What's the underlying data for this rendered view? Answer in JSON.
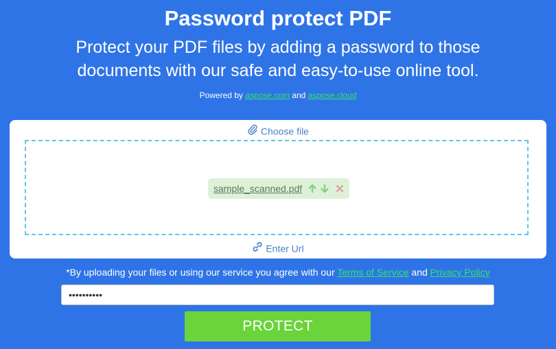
{
  "header": {
    "title": "Password protect PDF",
    "subtitle_line1": "Protect your PDF files by adding a password to those",
    "subtitle_line2": "documents with our safe and easy-to-use online tool.",
    "powered_prefix": "Powered by",
    "powered_link1": "aspose.com",
    "powered_and": "and",
    "powered_link2": "aspose.cloud"
  },
  "upload": {
    "choose_file_label": "Choose file",
    "choose_file_icon": "paperclip-icon",
    "file_name": "sample_scanned.pdf",
    "file_actions": [
      "arrow-up-icon",
      "arrow-down-icon",
      "remove-icon"
    ],
    "enter_url_label": "Enter Url",
    "enter_url_icon": "link-icon"
  },
  "agreement": {
    "prefix": "*By uploading your files or using our service you agree with our",
    "terms_label": "Terms of Service",
    "and": "and",
    "privacy_label": "Privacy Policy"
  },
  "password": {
    "value": "••••••••••"
  },
  "protect_button_label": "PROTECT",
  "colors": {
    "background": "#2f74e6",
    "link_green": "#32e26a",
    "button_green": "#6ad43a",
    "dropzone_border": "#5cc6ec",
    "chip_bg": "#dff0d8"
  }
}
